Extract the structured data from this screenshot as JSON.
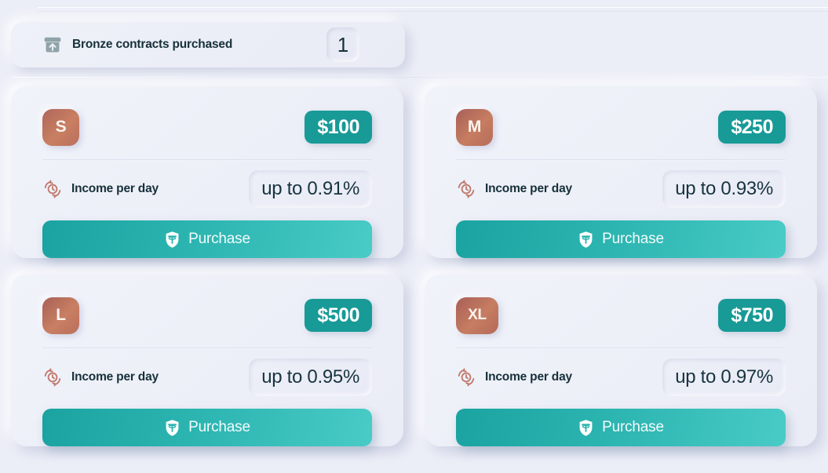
{
  "summary": {
    "icon": "archive-upload-icon",
    "label": "Bronze contracts purchased",
    "value": "1"
  },
  "labels": {
    "income_per_day": "Income per day",
    "purchase": "Purchase",
    "rate_icon": "clock-refresh-icon",
    "purchase_icon": "shield-tether-icon"
  },
  "colors": {
    "page_background": "#eceef7",
    "card_background": "#eff1f9",
    "price_badge": "#189a97",
    "purchase_gradient_start": "#1aa3a0",
    "purchase_gradient_end": "#49cbc6",
    "tier_badge_start": "#a8625a",
    "tier_badge_end": "#c9785e",
    "text_dark": "#16303a",
    "rate_icon": "#c0796c"
  },
  "plans": [
    {
      "tier": "S",
      "price": "$100",
      "income_label": "Income per day",
      "income_value": "up to 0.91%",
      "purchase_label": "Purchase"
    },
    {
      "tier": "M",
      "price": "$250",
      "income_label": "Income per day",
      "income_value": "up to 0.93%",
      "purchase_label": "Purchase"
    },
    {
      "tier": "L",
      "price": "$500",
      "income_label": "Income per day",
      "income_value": "up to 0.95%",
      "purchase_label": "Purchase"
    },
    {
      "tier": "XL",
      "price": "$750",
      "income_label": "Income per day",
      "income_value": "up to 0.97%",
      "purchase_label": "Purchase"
    }
  ]
}
